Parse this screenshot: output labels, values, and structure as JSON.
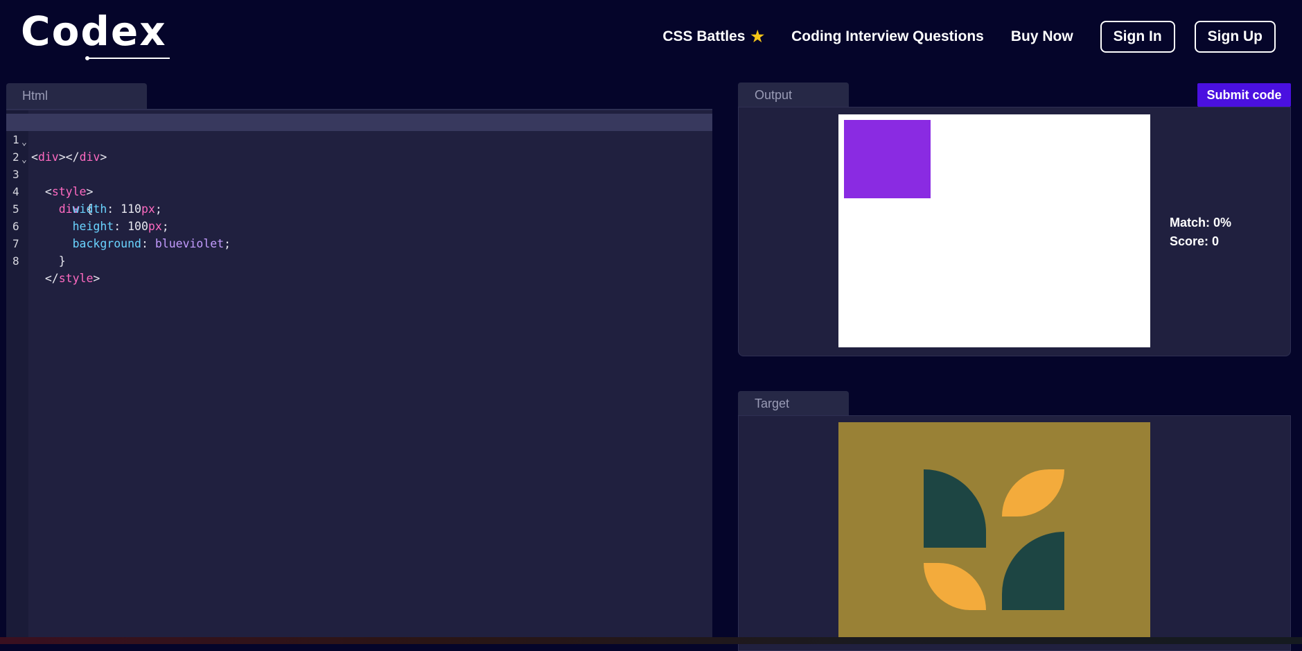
{
  "header": {
    "logo_text": "Codex",
    "nav": [
      {
        "label": "CSS Battles",
        "icon": "star-icon"
      },
      {
        "label": "Coding Interview Questions"
      },
      {
        "label": "Buy Now"
      }
    ],
    "sign_in": "Sign In",
    "sign_up": "Sign Up"
  },
  "editor": {
    "tab": "Html",
    "lines": [
      {
        "n": "1",
        "fold": ""
      },
      {
        "n": "2",
        "fold": "⌄"
      },
      {
        "n": "3",
        "fold": "⌄"
      },
      {
        "n": "4",
        "fold": ""
      },
      {
        "n": "5",
        "fold": ""
      },
      {
        "n": "6",
        "fold": ""
      },
      {
        "n": "7",
        "fold": ""
      },
      {
        "n": "8",
        "fold": ""
      }
    ],
    "tokens": {
      "div": "div",
      "style": "style",
      "width_prop": "width",
      "width_num": "110",
      "height_prop": "height",
      "height_num": "100",
      "bg_prop": "background",
      "bg_val": "blueviolet",
      "unit": "px"
    }
  },
  "output": {
    "tab": "Output",
    "submit": "Submit code",
    "match": "Match: 0%",
    "score": "Score: 0",
    "box_color": "#8a2be2"
  },
  "target": {
    "tab": "Target",
    "background": "#998136",
    "dark_leaf": "#1d4543",
    "light_leaf": "#f3ab3c"
  }
}
